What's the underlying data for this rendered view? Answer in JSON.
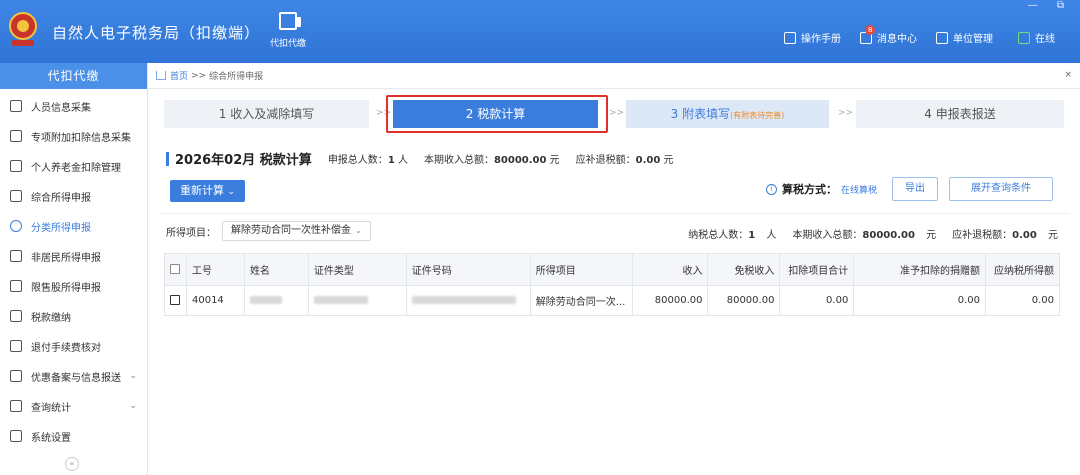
{
  "app": {
    "title": "自然人电子税务局（扣缴端）",
    "top_tool_label": "代扣代缴"
  },
  "top_right": {
    "manual": "操作手册",
    "messages": "消息中心",
    "message_count": "8",
    "unit": "单位管理",
    "online": "在线",
    "window_controls": "— ⧉"
  },
  "sidebar": {
    "header": "代扣代缴",
    "items": [
      {
        "label": "人员信息采集"
      },
      {
        "label": "专项附加扣除信息采集"
      },
      {
        "label": "个人养老金扣除管理"
      },
      {
        "label": "综合所得申报"
      },
      {
        "label": "分类所得申报"
      },
      {
        "label": "非居民所得申报"
      },
      {
        "label": "限售股所得申报"
      },
      {
        "label": "税款缴纳"
      },
      {
        "label": "退付手续费核对"
      },
      {
        "label": "优惠备案与信息报送"
      },
      {
        "label": "查询统计"
      },
      {
        "label": "系统设置"
      }
    ],
    "chevron": "⌄",
    "collapse": "«"
  },
  "breadcrumb": {
    "home": "首页",
    "sep": ">>",
    "current": "综合所得申报",
    "close": "×"
  },
  "steps": [
    {
      "label": "1 收入及减除填写"
    },
    {
      "label": "2 税款计算"
    },
    {
      "label": "3 附表填写",
      "note": "(有附表待完善)"
    },
    {
      "label": "4 申报表报送"
    }
  ],
  "step_arrow": ">>",
  "summary": {
    "period": "2026年02月 税款计算",
    "people_label": "申报总人数：",
    "people_value": "1",
    "people_unit": "人",
    "income_label": "本期收入总额：",
    "income_value": "80000.00",
    "income_unit": "元",
    "refund_label": "应补退税额：",
    "refund_value": "0.00",
    "refund_unit": "元"
  },
  "actions": {
    "recalc": "重新计算",
    "recalc_dd": "⌄",
    "method_label": "算税方式：",
    "method_value": "在线算税",
    "export": "导出",
    "expand": "展开查询条件"
  },
  "filter": {
    "label": "所得项目：",
    "value": "解除劳动合同一次性补偿金",
    "dd": "⌄"
  },
  "totals": {
    "people_label": "纳税总人数：",
    "people_value": "1",
    "people_unit": "人",
    "income_label": "本期收入总额：",
    "income_value": "80000.00",
    "income_unit": "元",
    "refund_label": "应补退税额：",
    "refund_value": "0.00",
    "refund_unit": "元"
  },
  "table": {
    "headers": [
      "工号",
      "姓名",
      "证件类型",
      "证件号码",
      "所得项目",
      "收入",
      "免税收入",
      "扣除项目合计",
      "准予扣除的捐赠额",
      "应纳税所得额"
    ],
    "rows": [
      {
        "id": "40014",
        "item": "解除劳动合同一次...",
        "income": "80000.00",
        "tax_free": "80000.00",
        "deduct_total": "0.00",
        "donation": "0.00",
        "taxable": "0.00"
      }
    ]
  },
  "colors": {
    "primary": "#3b7ddd",
    "highlight_border": "#e0302b",
    "note_orange": "#f08a24"
  }
}
